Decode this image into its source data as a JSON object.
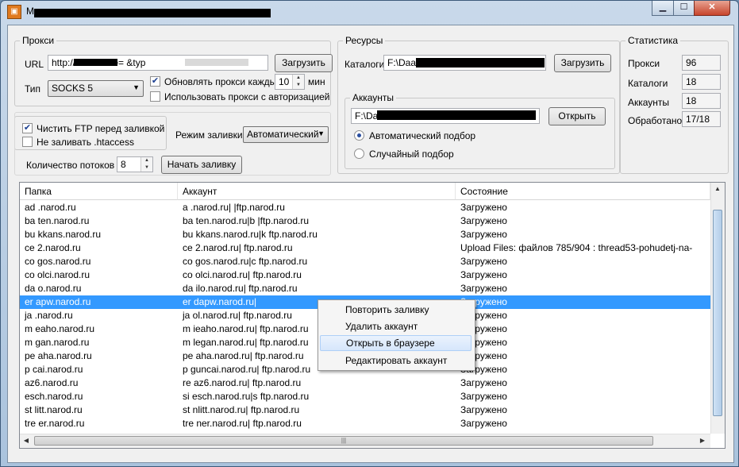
{
  "window": {
    "title": "M",
    "icon": "app-icon",
    "controls": [
      "minimize-icon",
      "maximize-icon",
      "close-icon"
    ]
  },
  "proxy": {
    "group_title": "Прокси",
    "url_label": "URL",
    "url_value": "http://              /list?code=               &typ",
    "load_button": "Загрузить",
    "type_label": "Тип",
    "type_value": "SOCKS 5",
    "update_check_label": "Обновлять прокси каждые",
    "update_interval": "10",
    "minutes_label": "мин",
    "auth_check_label": "Использовать прокси с авторизацией"
  },
  "resources": {
    "group_title": "Ресурсы",
    "catalogs_label": "Каталоги",
    "catalogs_value": "F:\\Daa\\",
    "load_button": "Загрузить",
    "accounts_group_title": "Аккаунты",
    "accounts_value": "F:\\Daa",
    "open_button": "Открыть",
    "radio_auto": "Автоматический подбор",
    "radio_random": "Случайный подбор"
  },
  "stats": {
    "group_title": "Статистика",
    "items": [
      {
        "label": "Прокси",
        "value": "96"
      },
      {
        "label": "Каталоги",
        "value": "18"
      },
      {
        "label": "Аккаунты",
        "value": "18"
      },
      {
        "label": "Обработано",
        "value": "17/18"
      }
    ]
  },
  "upload": {
    "clean_ftp_label": "Чистить FTP перед заливкой",
    "no_htaccess_label": "Не заливать .htaccess",
    "mode_label": "Режим заливки",
    "mode_value": "Автоматический",
    "threads_label": "Количество потоков",
    "threads_value": "8",
    "start_button": "Начать заливку"
  },
  "table": {
    "columns": [
      "Папка",
      "Аккаунт",
      "Состояние"
    ],
    "rows": [
      {
        "folder": "ad .narod.ru",
        "account": "a .narod.ru|  |ftp.narod.ru",
        "status": "Загружено"
      },
      {
        "folder": "ba ten.narod.ru",
        "account": "ba ten.narod.ru|b  |ftp.narod.ru",
        "status": "Загружено"
      },
      {
        "folder": "bu kkans.narod.ru",
        "account": "bu kkans.narod.ru|k  ftp.narod.ru",
        "status": "Загружено"
      },
      {
        "folder": "ce 2.narod.ru",
        "account": "ce 2.narod.ru|  ftp.narod.ru",
        "status": "Upload Files:          файлов 785/904   : thread53-pohudetj-na-"
      },
      {
        "folder": "co gos.narod.ru",
        "account": "co gos.narod.ru|c  ftp.narod.ru",
        "status": "Загружено"
      },
      {
        "folder": "co olci.narod.ru",
        "account": "co olci.narod.ru|  ftp.narod.ru",
        "status": "Загружено"
      },
      {
        "folder": "da o.narod.ru",
        "account": "da ilo.narod.ru|  ftp.narod.ru",
        "status": "Загружено"
      },
      {
        "folder": "er apw.narod.ru",
        "account": "er dapw.narod.ru|",
        "status": "Загружено"
      },
      {
        "folder": "ja .narod.ru",
        "account": "ja ol.narod.ru|  ftp.narod.ru",
        "status": "Загружено"
      },
      {
        "folder": "m eaho.narod.ru",
        "account": "m ieaho.narod.ru|  ftp.narod.ru",
        "status": "Загружено"
      },
      {
        "folder": "m gan.narod.ru",
        "account": "m legan.narod.ru|  ftp.narod.ru",
        "status": "Загружено"
      },
      {
        "folder": "pe aha.narod.ru",
        "account": "pe aha.narod.ru|  ftp.narod.ru",
        "status": "Загружено"
      },
      {
        "folder": "p cai.narod.ru",
        "account": "p guncai.narod.ru|  ftp.narod.ru",
        "status": "Загружено"
      },
      {
        "folder": "az6.narod.ru",
        "account": "re az6.narod.ru|  ftp.narod.ru",
        "status": "Загружено"
      },
      {
        "folder": "esch.narod.ru",
        "account": "si esch.narod.ru|s  ftp.narod.ru",
        "status": "Загружено"
      },
      {
        "folder": "st litt.narod.ru",
        "account": "st nlitt.narod.ru|  ftp.narod.ru",
        "status": "Загружено"
      },
      {
        "folder": "tre er.narod.ru",
        "account": "tre ner.narod.ru|  ftp.narod.ru",
        "status": "Загружено"
      }
    ],
    "selected_index": 7
  },
  "context_menu": {
    "items": [
      "Повторить заливку",
      "Удалить аккаунт",
      "Открыть в браузере",
      "Редактировать аккаунт"
    ],
    "highlighted_index": 2
  }
}
